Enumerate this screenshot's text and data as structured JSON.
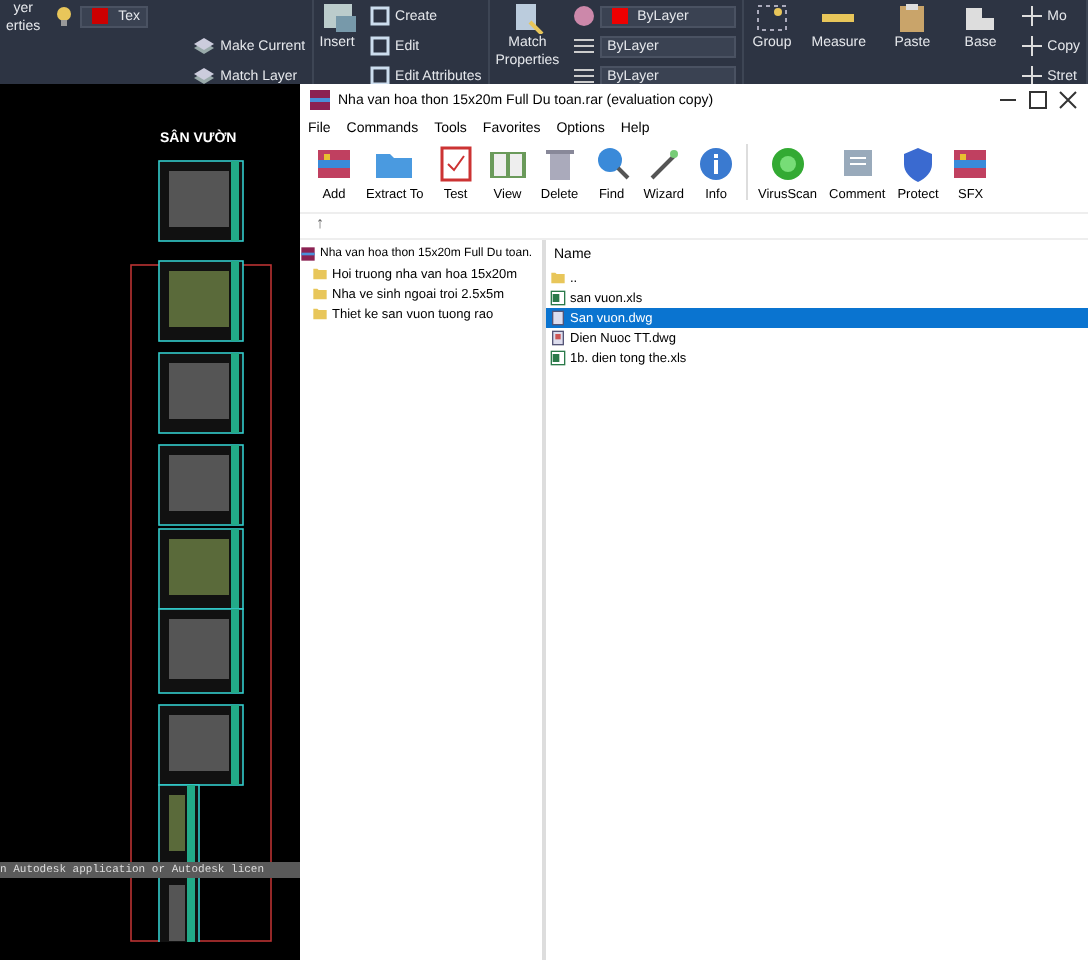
{
  "ribbon": {
    "layer_properties": [
      "yer",
      "erties"
    ],
    "layer_dropdown": "Tex",
    "layer_tools": [
      "Make Current",
      "Match Layer"
    ],
    "insert": "Insert",
    "block_tools": [
      "Create",
      "Edit",
      "Edit Attributes"
    ],
    "match_properties": [
      "Match",
      "Properties"
    ],
    "property_dropdowns": [
      "ByLayer",
      "ByLayer",
      "ByLayer"
    ],
    "group": "Group",
    "measure": "Measure",
    "paste": "Paste",
    "base": "Base",
    "modify_tools": [
      "Mo",
      "Copy",
      "Stret"
    ]
  },
  "cad": {
    "title": "SÂN VƯỜN",
    "command_line": "n Autodesk application or Autodesk licen"
  },
  "archiver": {
    "title": "Nha van hoa thon 15x20m Full Du toan.rar (evaluation copy)",
    "menu": [
      "File",
      "Commands",
      "Tools",
      "Favorites",
      "Options",
      "Help"
    ],
    "toolbar": [
      {
        "label": "Add",
        "kind": "add"
      },
      {
        "label": "Extract To",
        "kind": "folder"
      },
      {
        "label": "Test",
        "kind": "test"
      },
      {
        "label": "View",
        "kind": "book"
      },
      {
        "label": "Delete",
        "kind": "trash"
      },
      {
        "label": "Find",
        "kind": "find"
      },
      {
        "label": "Wizard",
        "kind": "wand"
      },
      {
        "label": "Info",
        "kind": "info"
      },
      {
        "label": "VirusScan",
        "kind": "scan"
      },
      {
        "label": "Comment",
        "kind": "comment"
      },
      {
        "label": "Protect",
        "kind": "shield"
      },
      {
        "label": "SFX",
        "kind": "add"
      }
    ],
    "up": "↑",
    "tree": {
      "label": "Nha van hoa thon 15x20m Full Du toan.",
      "children": [
        {
          "label": "Hoi truong nha van hoa 15x20m"
        },
        {
          "label": "Nha ve sinh ngoai troi 2.5x5m"
        },
        {
          "label": "Thiet ke san vuon tuong rao"
        }
      ]
    },
    "column": "Name",
    "files": [
      {
        "name": "..",
        "kind": "folder",
        "selected": false
      },
      {
        "name": "san vuon.xls",
        "kind": "xls",
        "selected": false
      },
      {
        "name": "San vuon.dwg",
        "kind": "dwg",
        "selected": true
      },
      {
        "name": "Dien Nuoc TT.dwg",
        "kind": "dwg2",
        "selected": false
      },
      {
        "name": "1b. dien tong the.xls",
        "kind": "xls",
        "selected": false
      }
    ]
  }
}
